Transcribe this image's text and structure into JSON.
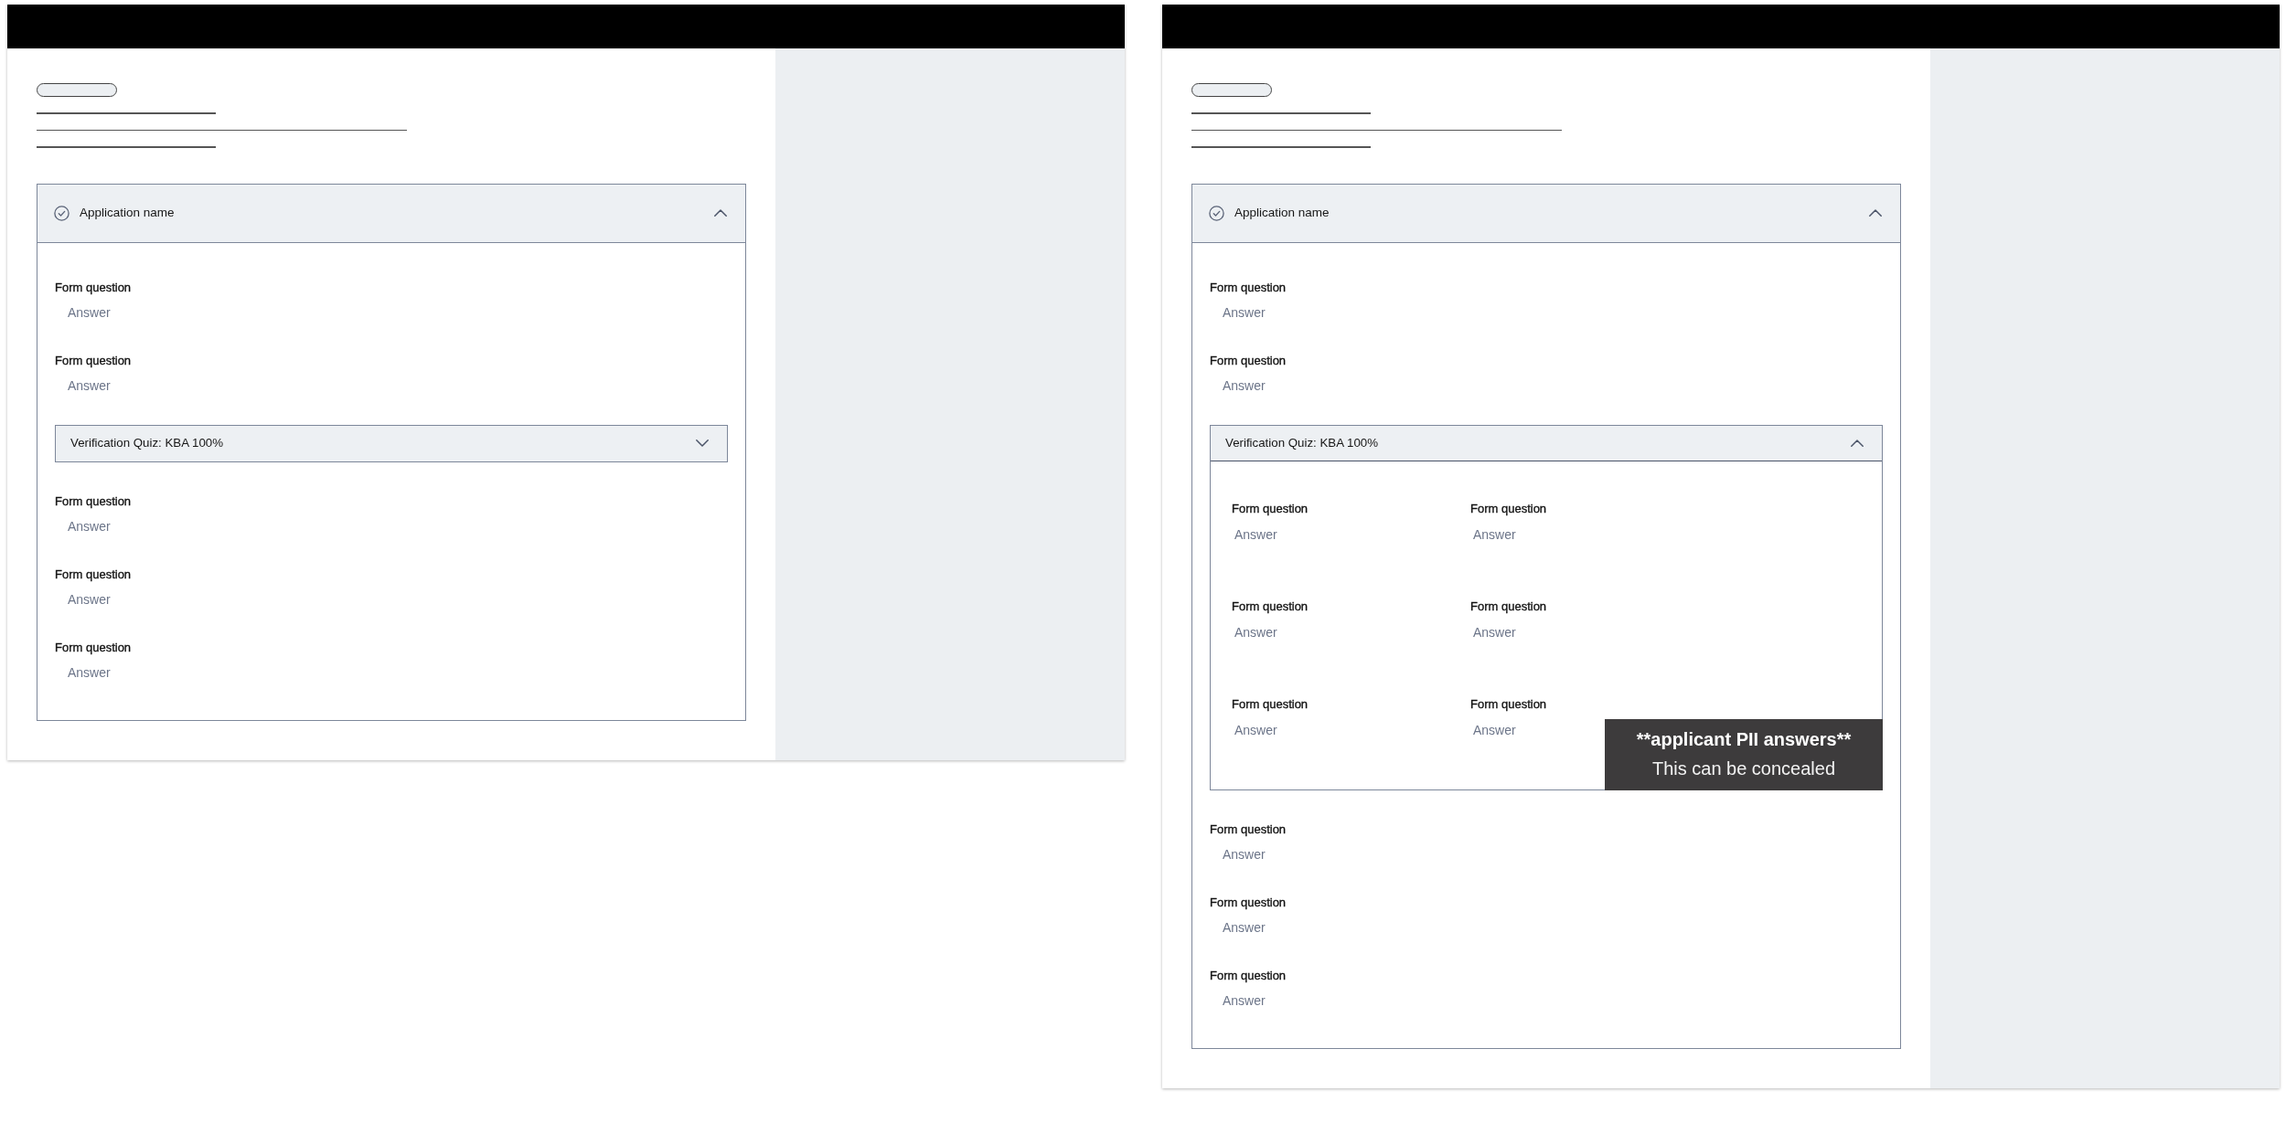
{
  "frames": [
    {
      "application": {
        "title": "Application name",
        "complete": true,
        "expanded": true,
        "sections": [
          {
            "kind": "question",
            "question": "Form question",
            "answer": "Answer"
          },
          {
            "kind": "question",
            "question": "Form question",
            "answer": "Answer"
          },
          {
            "kind": "quiz",
            "title": "Verification Quiz: KBA 100%",
            "expanded": false
          },
          {
            "kind": "question",
            "question": "Form question",
            "answer": "Answer"
          },
          {
            "kind": "question",
            "question": "Form question",
            "answer": "Answer"
          },
          {
            "kind": "question",
            "question": "Form question",
            "answer": "Answer"
          }
        ]
      }
    },
    {
      "application": {
        "title": "Application name",
        "complete": true,
        "expanded": true,
        "sections": [
          {
            "kind": "question",
            "question": "Form question",
            "answer": "Answer"
          },
          {
            "kind": "question",
            "question": "Form question",
            "answer": "Answer"
          },
          {
            "kind": "quiz",
            "title": "Verification Quiz: KBA 100%",
            "expanded": true,
            "items": [
              {
                "question": "Form question",
                "answer": "Answer"
              },
              {
                "question": "Form question",
                "answer": "Answer"
              },
              {
                "question": "Form question",
                "answer": "Answer"
              },
              {
                "question": "Form question",
                "answer": "Answer"
              },
              {
                "question": "Form question",
                "answer": "Answer"
              },
              {
                "question": "Form question",
                "answer": "Answer"
              }
            ],
            "note": {
              "title": "**applicant PII answers**",
              "text": "This can be concealed"
            }
          },
          {
            "kind": "question",
            "question": "Form question",
            "answer": "Answer"
          },
          {
            "kind": "question",
            "question": "Form question",
            "answer": "Answer"
          },
          {
            "kind": "question",
            "question": "Form question",
            "answer": "Answer"
          }
        ]
      }
    }
  ]
}
